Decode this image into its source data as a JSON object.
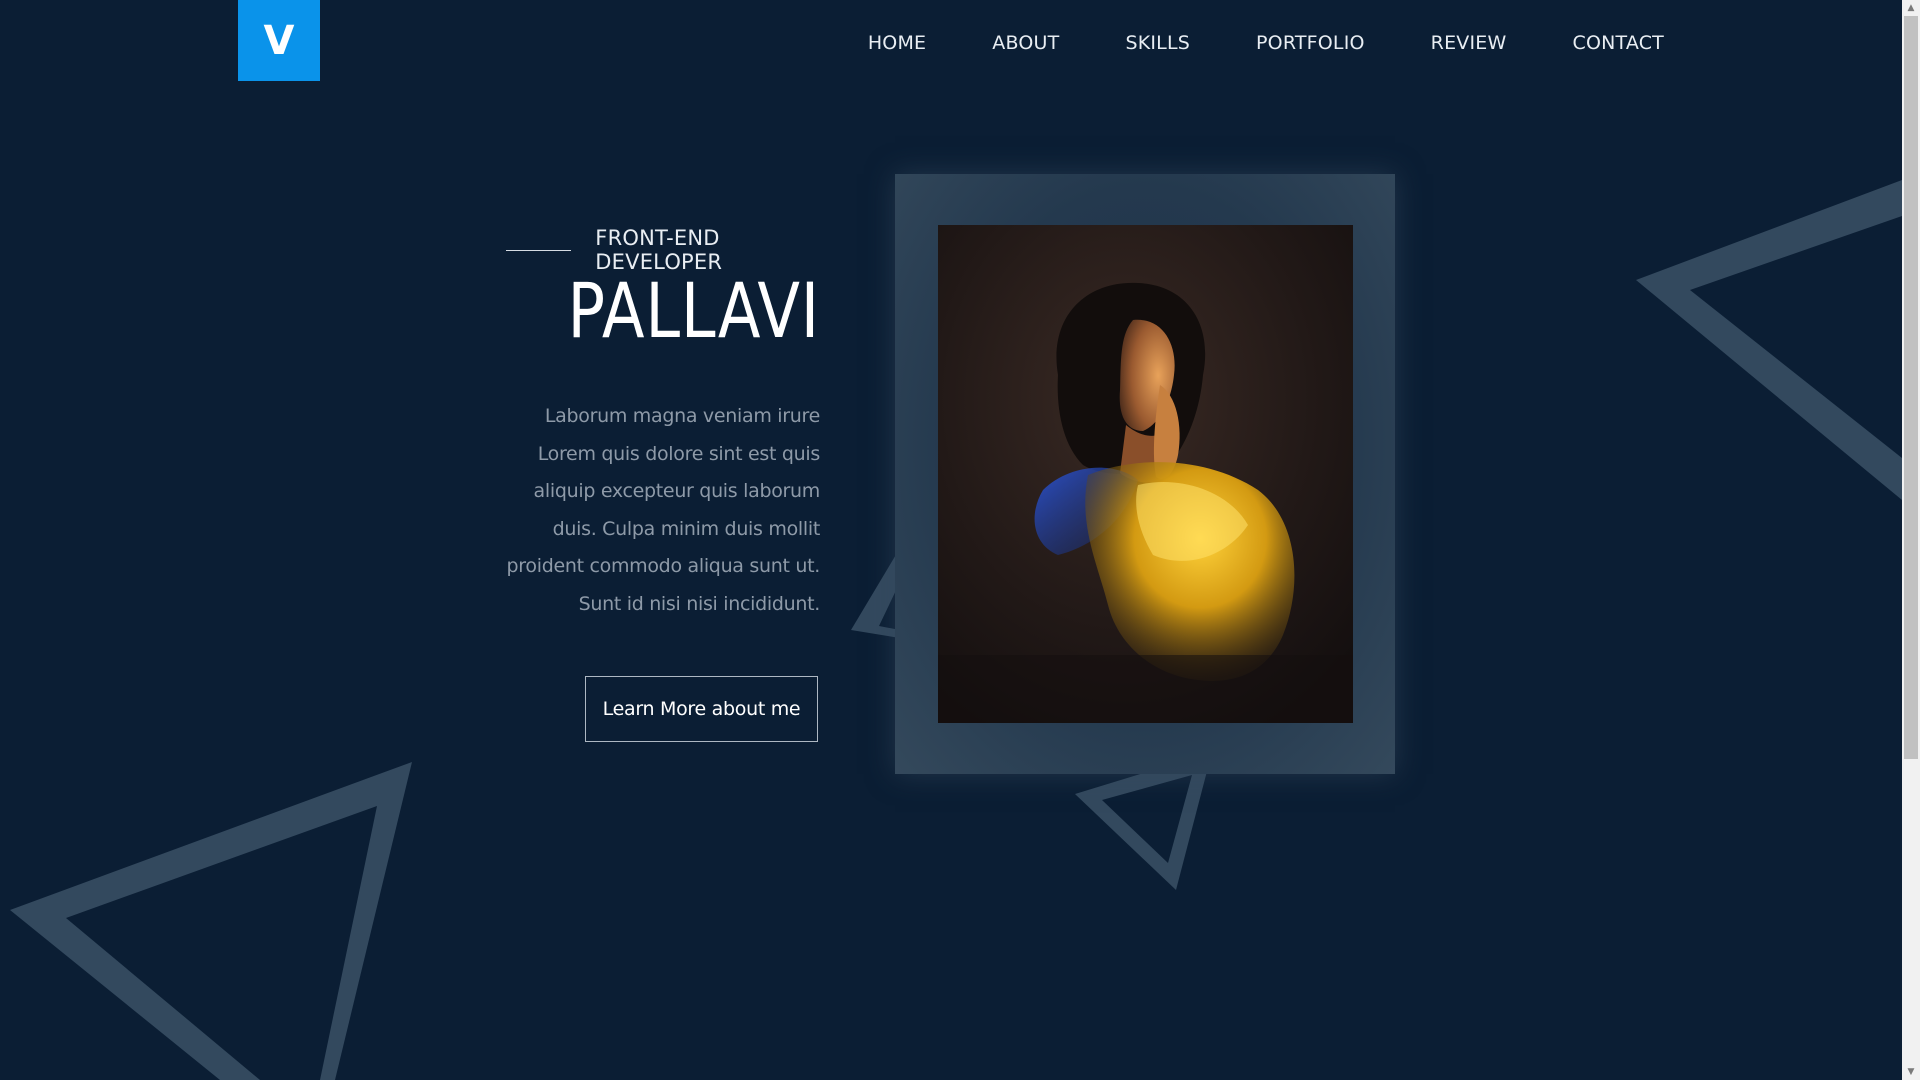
{
  "logo": {
    "letter": "V"
  },
  "nav": {
    "items": [
      {
        "label": "HOME"
      },
      {
        "label": "ABOUT"
      },
      {
        "label": "SKILLS"
      },
      {
        "label": "PORTFOLIO"
      },
      {
        "label": "REVIEW"
      },
      {
        "label": "CONTACT"
      }
    ]
  },
  "hero": {
    "subtitle": "FRONT-END DEVELOPER",
    "name": "PALLAVI",
    "description": "Laborum magna veniam irure Lorem quis dolore sint est quis aliquip excepteur quis laborum duis. Culpa minim duis mollit proident commodo aliqua sunt ut. Sunt id nisi nisi incididunt.",
    "cta_label": "Learn More about me"
  },
  "colors": {
    "background": "#0b1e34",
    "accent": "#0a93ea",
    "triangle": "#33495e",
    "text": "#e9eef3",
    "muted_text": "#8e9aa8"
  },
  "icons": {
    "scroll_up": "triangle-up-icon",
    "scroll_down": "triangle-down-icon"
  }
}
